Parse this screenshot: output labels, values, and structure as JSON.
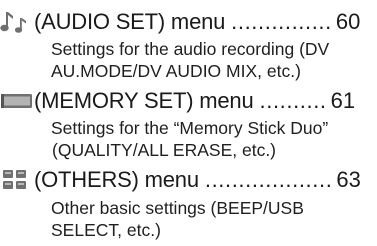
{
  "entries": [
    {
      "icon": "audio-notes-icon",
      "title": "(AUDIO SET) menu",
      "leader": "...............",
      "page": "60",
      "desc_lines": [
        "Settings for the audio recording (DV",
        "AU.MODE/DV AUDIO MIX, etc.)"
      ]
    },
    {
      "icon": "memory-stick-icon",
      "title": "(MEMORY SET) menu",
      "leader": "..........",
      "page": "61",
      "desc_lines": [
        "Settings for the “Memory Stick Duo”",
        "(QUALITY/ALL ERASE, etc.)"
      ]
    },
    {
      "icon": "others-grid-icon",
      "title": "(OTHERS) menu",
      "leader": "...................",
      "page": "63",
      "desc_lines": [
        "Other basic settings (BEEP/USB",
        "SELECT, etc.)"
      ]
    }
  ]
}
